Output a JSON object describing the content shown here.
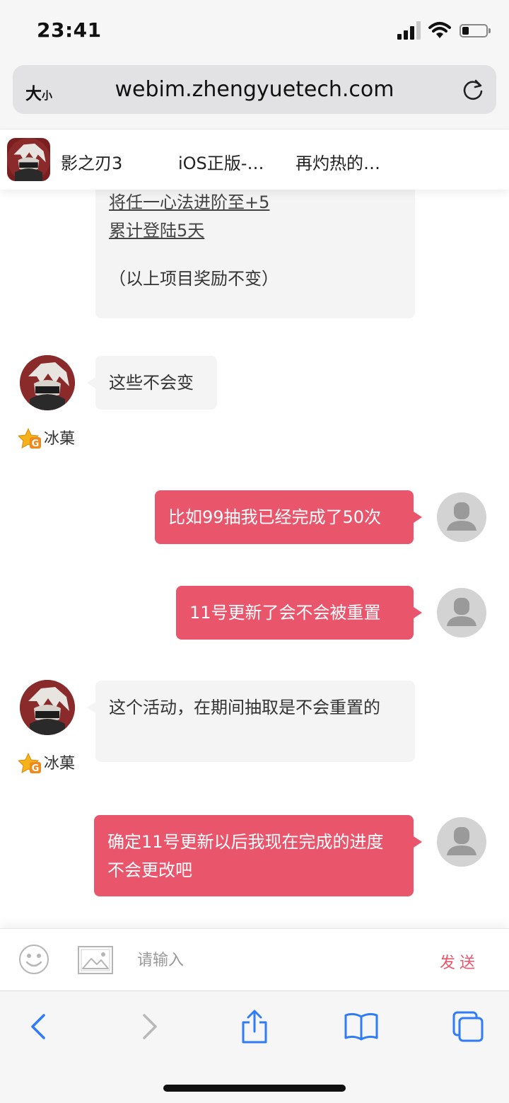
{
  "status": {
    "time": "23:41"
  },
  "browser": {
    "aa_big": "大",
    "aa_small": "小",
    "url": "webim.zhengyuetech.com"
  },
  "header": {
    "items": [
      "影之刃3",
      "iOS正版-…",
      "再灼热的…"
    ]
  },
  "messages": {
    "m0": {
      "line1": "将任一心法进阶至+5",
      "line2": "累计登陆5天",
      "line3": "（以上项目奖励不变）"
    },
    "m1": {
      "text": "这些不会变",
      "sender": "冰菓"
    },
    "m2": {
      "text": "比如99抽我已经完成了50次"
    },
    "m3": {
      "text": "11号更新了会不会被重置"
    },
    "m4": {
      "text": "这个活动，在期间抽取是不会重置的",
      "sender": "冰菓"
    },
    "m5": {
      "text": "确定11号更新以后我现在完成的进度不会更改吧"
    }
  },
  "input": {
    "placeholder": "请输入",
    "send_label": "发送"
  },
  "colors": {
    "accent": "#e9566c",
    "incoming_bubble": "#f4f4f4"
  },
  "icons": {
    "emoji": "smiley-face-icon",
    "image": "image-icon",
    "back": "chevron-left-icon",
    "forward": "chevron-right-icon",
    "share": "share-icon",
    "bookmarks": "book-icon",
    "tabs": "tabs-icon"
  }
}
